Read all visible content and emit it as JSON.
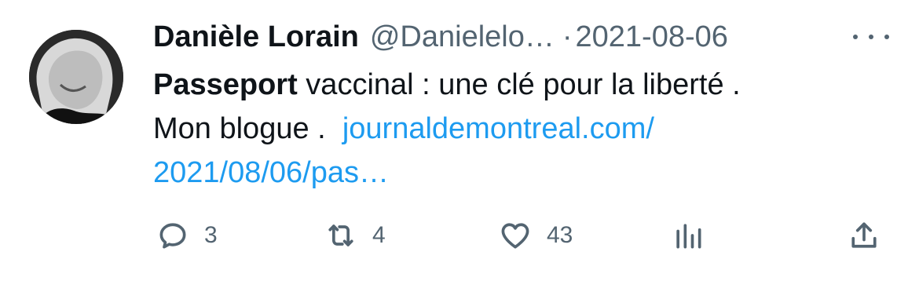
{
  "tweet": {
    "author_name": "Danièle Lorain",
    "handle": "@Danielelo…",
    "separator": "·",
    "date": "2021-08-06",
    "text_bold": "Passeport",
    "text_rest": " vaccinal : une clé pour la liberté .",
    "text_line2": "Mon blogue .",
    "link_line1": "journaldemontreal.com/",
    "link_line2": "2021/08/06/pas…"
  },
  "actions": {
    "reply_count": "3",
    "retweet_count": "4",
    "like_count": "43"
  },
  "icons": {
    "more": "more-horizontal-icon",
    "reply": "reply-icon",
    "retweet": "retweet-icon",
    "like": "heart-icon",
    "views": "views-chart-icon",
    "share": "share-icon"
  },
  "colors": {
    "text": "#0f1419",
    "secondary": "#536471",
    "link": "#1d9bf0",
    "background": "#ffffff"
  }
}
